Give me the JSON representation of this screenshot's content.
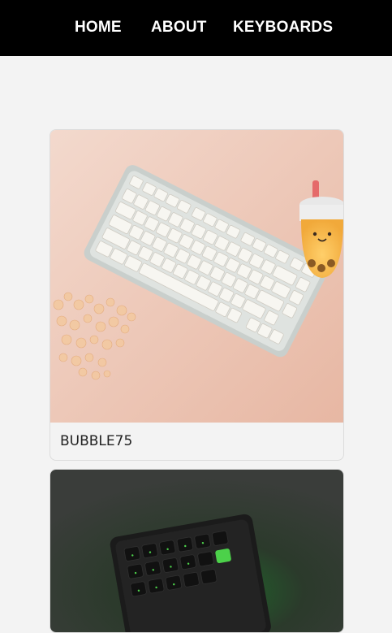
{
  "nav": {
    "items": [
      {
        "label": "HOME"
      },
      {
        "label": "ABOUT"
      },
      {
        "label": "KEYBOARDS"
      }
    ]
  },
  "products": [
    {
      "name": "BUBBLE75",
      "image": "keyboard-photo"
    },
    {
      "name": "",
      "image": "keyboard-photo"
    }
  ],
  "colors": {
    "nav_bg": "#000000",
    "page_bg": "#f3f3f3",
    "nav_text": "#ffffff"
  }
}
